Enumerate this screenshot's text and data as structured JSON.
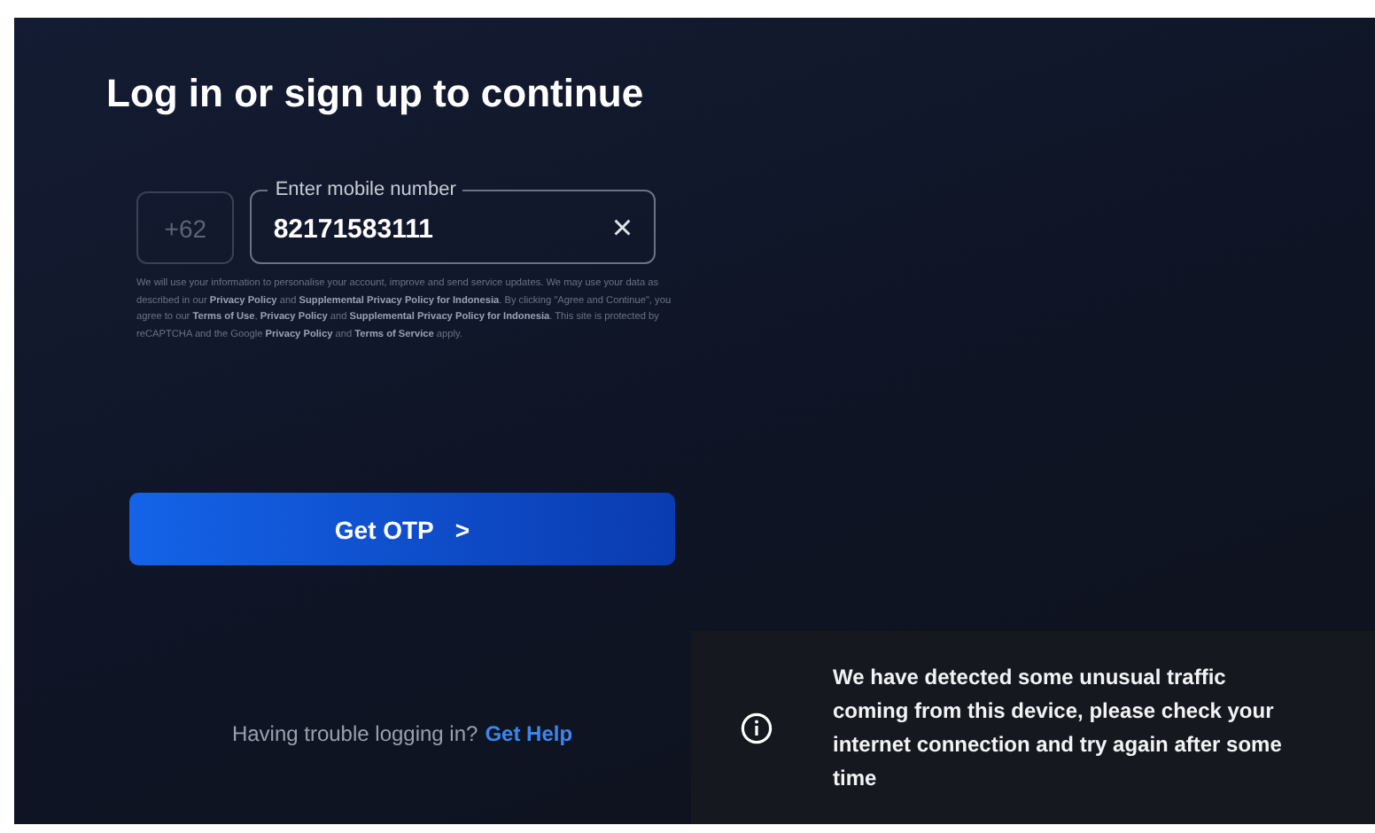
{
  "title": "Log in or sign up to continue",
  "country_code": "+62",
  "phone_field": {
    "label": "Enter mobile number",
    "value": "82171583111"
  },
  "clear_icon": "×",
  "disclaimer": "We will use your information to personalise your account, improve and send service updates. We may use your data as described in our **Privacy Policy** and **Supplemental Privacy Policy for Indonesia**. By clicking \"Agree and Continue\", you agree to our **Terms of Use**, **Privacy Policy** and **Supplemental Privacy Policy for Indonesia**. This site is protected by reCAPTCHA and the Google **Privacy Policy** and **Terms of Service** apply.",
  "submit_button": {
    "label": "Get OTP",
    "arrow": ">"
  },
  "help": {
    "text": "Having trouble logging in?",
    "link": "Get Help"
  },
  "toast": {
    "message": "We have detected some unusual traffic coming from this device, please check your internet connection and try again after some time"
  }
}
